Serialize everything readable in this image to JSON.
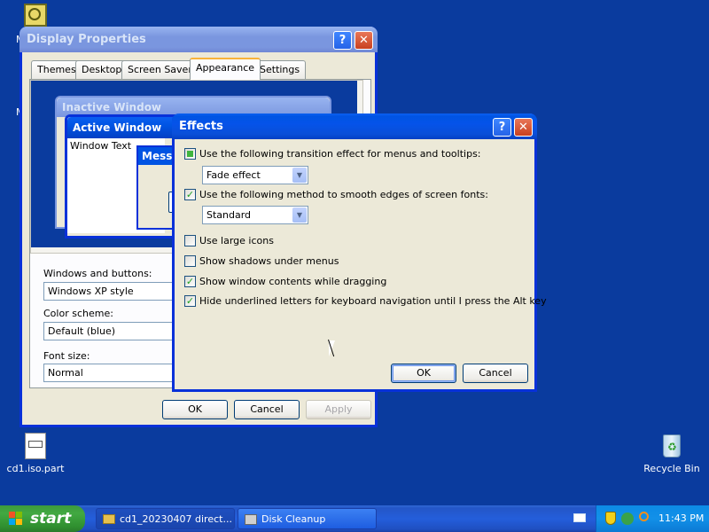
{
  "desktop": {
    "icons": [
      {
        "label": "cd1.iso.part",
        "icon": "iso-file-icon"
      },
      {
        "label": "Recycle Bin",
        "icon": "recycle-bin-icon"
      }
    ]
  },
  "display_properties": {
    "title": "Display Properties",
    "tabs": [
      "Themes",
      "Desktop",
      "Screen Saver",
      "Appearance",
      "Settings"
    ],
    "active_tab": "Appearance",
    "preview": {
      "inactive_title": "Inactive Window",
      "active_title": "Active Window",
      "window_text": "Window Text",
      "message_title": "Messa"
    },
    "windows_buttons_label": "Windows and buttons:",
    "windows_buttons_value": "Windows XP style",
    "color_scheme_label": "Color scheme:",
    "color_scheme_value": "Default (blue)",
    "font_size_label": "Font size:",
    "font_size_value": "Normal",
    "ok": "OK",
    "cancel": "Cancel",
    "apply": "Apply"
  },
  "effects": {
    "title": "Effects",
    "options": {
      "transition_label": "Use the following transition effect for menus and tooltips:",
      "transition_value": "Fade effect",
      "smooth_label": "Use the following method to smooth edges of screen fonts:",
      "smooth_value": "Standard",
      "large_icons": "Use large icons",
      "shadows": "Show shadows under menus",
      "drag_contents": "Show window contents while dragging",
      "hide_underlines": "Hide underlined letters for keyboard navigation until I press the Alt key"
    },
    "ok": "OK",
    "cancel": "Cancel"
  },
  "taskbar": {
    "start": "start",
    "tasks": [
      "cd1_20230407 direct...",
      "Disk Cleanup"
    ],
    "clock": "11:43 PM"
  },
  "colors": {
    "desktop": "#0a3b9e",
    "title_active": "#0054e3",
    "taskbar": "#245edb",
    "start": "#3c9a3c"
  }
}
